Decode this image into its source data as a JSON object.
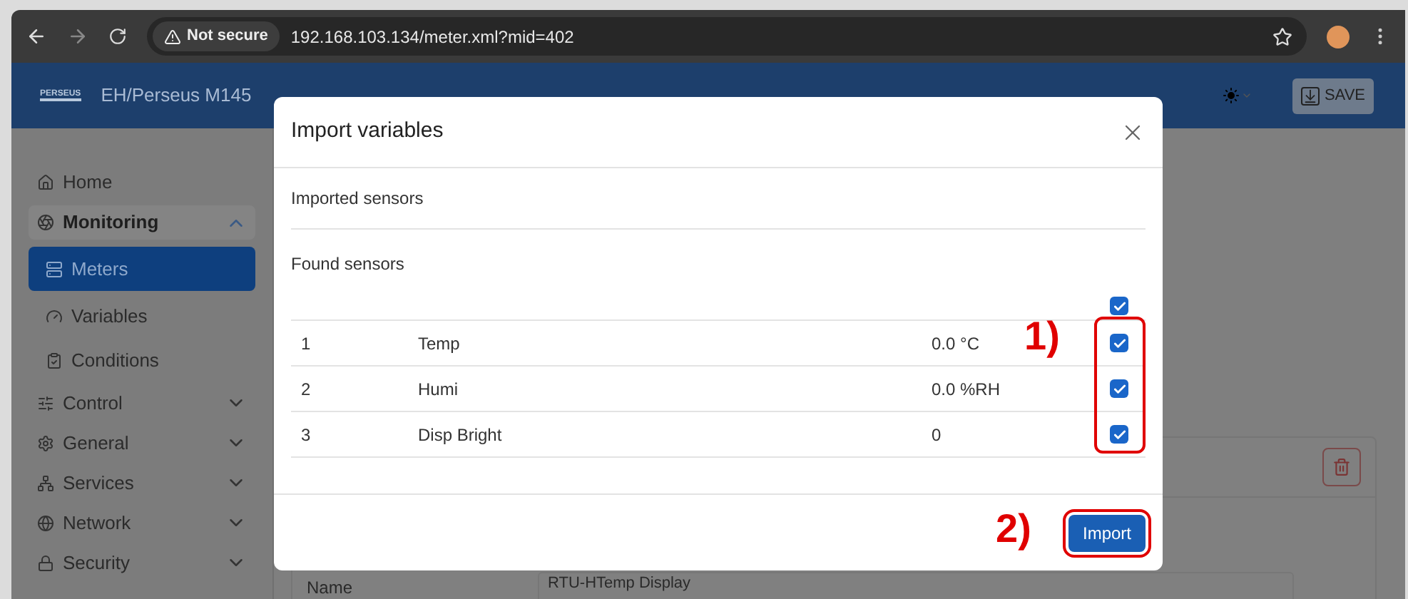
{
  "browser": {
    "security": "Not secure",
    "url": "192.168.103.134/meter.xml?mid=402"
  },
  "header": {
    "logo": "PERSEUS",
    "title": "EH/Perseus M145",
    "save": "SAVE"
  },
  "sidebar": {
    "items": [
      {
        "label": "Home",
        "kind": "link"
      },
      {
        "label": "Monitoring",
        "kind": "group",
        "expanded": true,
        "children": [
          {
            "label": "Meters",
            "selected": true
          },
          {
            "label": "Variables",
            "selected": false
          },
          {
            "label": "Conditions",
            "selected": false
          }
        ]
      },
      {
        "label": "Control",
        "kind": "group",
        "expanded": false
      },
      {
        "label": "General",
        "kind": "group",
        "expanded": false
      },
      {
        "label": "Services",
        "kind": "group",
        "expanded": false
      },
      {
        "label": "Network",
        "kind": "group",
        "expanded": false
      },
      {
        "label": "Security",
        "kind": "group",
        "expanded": false
      }
    ]
  },
  "form": {
    "label": "Name",
    "value": "RTU-HTemp Display"
  },
  "modal": {
    "title": "Import variables",
    "imported_heading": "Imported sensors",
    "found_heading": "Found sensors",
    "select_all": {
      "checked": true
    },
    "rows": [
      {
        "number": "1",
        "name": "Temp",
        "value": "0.0 °C",
        "checked": true
      },
      {
        "number": "2",
        "name": "Humi",
        "value": "0.0 %RH",
        "checked": true
      },
      {
        "number": "3",
        "name": "Disp Bright",
        "value": "0",
        "checked": true
      }
    ],
    "button": "Import",
    "annotations": [
      "1)",
      "2)"
    ]
  }
}
